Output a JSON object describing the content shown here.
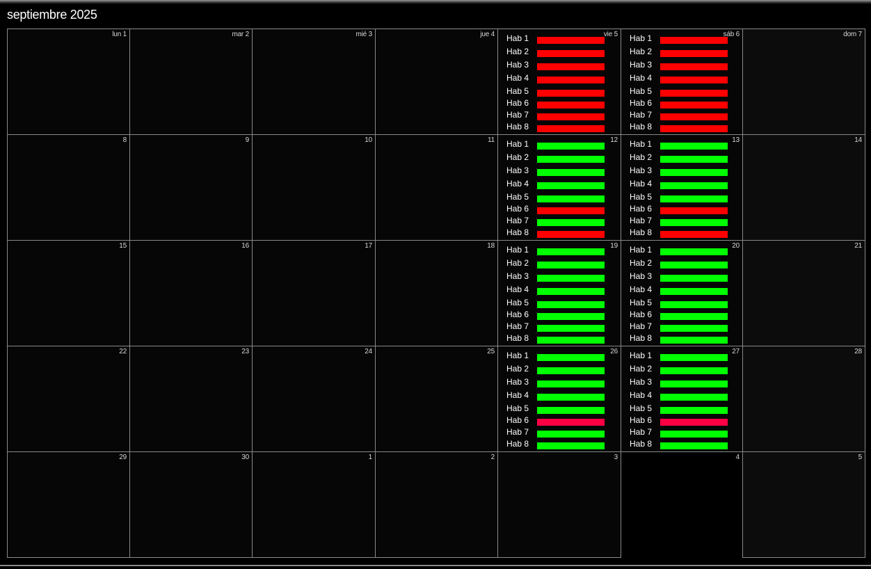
{
  "calendar": {
    "title": "septiembre 2025",
    "colors": {
      "available": "#00ff00",
      "occupied": "#ff0000",
      "blocked": "#ff0044"
    },
    "weeks": [
      {
        "days": [
          {
            "label": "lun 1"
          },
          {
            "label": "mar 2"
          },
          {
            "label": "mié 3"
          },
          {
            "label": "jue 4"
          },
          {
            "label": "vie 5",
            "rooms": [
              {
                "name": "Hab 1",
                "status": "occupied"
              },
              {
                "name": "Hab 2",
                "status": "occupied"
              },
              {
                "name": "Hab 3",
                "status": "occupied"
              },
              {
                "name": "Hab 4",
                "status": "occupied"
              },
              {
                "name": "Hab 5",
                "status": "occupied"
              },
              {
                "name": "Hab 6",
                "status": "occupied"
              },
              {
                "name": "Hab 7",
                "status": "occupied"
              },
              {
                "name": "Hab 8",
                "status": "occupied"
              }
            ]
          },
          {
            "label": "sáb 6",
            "rooms": [
              {
                "name": "Hab 1",
                "status": "occupied"
              },
              {
                "name": "Hab 2",
                "status": "occupied"
              },
              {
                "name": "Hab 3",
                "status": "occupied"
              },
              {
                "name": "Hab 4",
                "status": "occupied"
              },
              {
                "name": "Hab 5",
                "status": "occupied"
              },
              {
                "name": "Hab 6",
                "status": "occupied"
              },
              {
                "name": "Hab 7",
                "status": "occupied"
              },
              {
                "name": "Hab 8",
                "status": "occupied"
              }
            ]
          },
          {
            "label": "dom 7"
          }
        ]
      },
      {
        "days": [
          {
            "label": "8"
          },
          {
            "label": "9"
          },
          {
            "label": "10"
          },
          {
            "label": "11"
          },
          {
            "label": "12",
            "rooms": [
              {
                "name": "Hab 1",
                "status": "available"
              },
              {
                "name": "Hab 2",
                "status": "available"
              },
              {
                "name": "Hab 3",
                "status": "available"
              },
              {
                "name": "Hab 4",
                "status": "available"
              },
              {
                "name": "Hab 5",
                "status": "available"
              },
              {
                "name": "Hab 6",
                "status": "occupied"
              },
              {
                "name": "Hab 7",
                "status": "available"
              },
              {
                "name": "Hab 8",
                "status": "occupied"
              }
            ]
          },
          {
            "label": "13",
            "rooms": [
              {
                "name": "Hab 1",
                "status": "available"
              },
              {
                "name": "Hab 2",
                "status": "available"
              },
              {
                "name": "Hab 3",
                "status": "available"
              },
              {
                "name": "Hab 4",
                "status": "available"
              },
              {
                "name": "Hab 5",
                "status": "available"
              },
              {
                "name": "Hab 6",
                "status": "occupied"
              },
              {
                "name": "Hab 7",
                "status": "available"
              },
              {
                "name": "Hab 8",
                "status": "occupied"
              }
            ]
          },
          {
            "label": "14"
          }
        ]
      },
      {
        "days": [
          {
            "label": "15"
          },
          {
            "label": "16"
          },
          {
            "label": "17"
          },
          {
            "label": "18"
          },
          {
            "label": "19",
            "rooms": [
              {
                "name": "Hab 1",
                "status": "available"
              },
              {
                "name": "Hab 2",
                "status": "available"
              },
              {
                "name": "Hab 3",
                "status": "available"
              },
              {
                "name": "Hab 4",
                "status": "available"
              },
              {
                "name": "Hab 5",
                "status": "available"
              },
              {
                "name": "Hab 6",
                "status": "available"
              },
              {
                "name": "Hab 7",
                "status": "available"
              },
              {
                "name": "Hab 8",
                "status": "available"
              }
            ]
          },
          {
            "label": "20",
            "rooms": [
              {
                "name": "Hab 1",
                "status": "available"
              },
              {
                "name": "Hab 2",
                "status": "available"
              },
              {
                "name": "Hab 3",
                "status": "available"
              },
              {
                "name": "Hab 4",
                "status": "available"
              },
              {
                "name": "Hab 5",
                "status": "available"
              },
              {
                "name": "Hab 6",
                "status": "available"
              },
              {
                "name": "Hab 7",
                "status": "available"
              },
              {
                "name": "Hab 8",
                "status": "available"
              }
            ]
          },
          {
            "label": "21"
          }
        ]
      },
      {
        "days": [
          {
            "label": "22"
          },
          {
            "label": "23"
          },
          {
            "label": "24"
          },
          {
            "label": "25"
          },
          {
            "label": "26",
            "rooms": [
              {
                "name": "Hab 1",
                "status": "available"
              },
              {
                "name": "Hab 2",
                "status": "available"
              },
              {
                "name": "Hab 3",
                "status": "available"
              },
              {
                "name": "Hab 4",
                "status": "available"
              },
              {
                "name": "Hab 5",
                "status": "available"
              },
              {
                "name": "Hab 6",
                "status": "blocked"
              },
              {
                "name": "Hab 7",
                "status": "available"
              },
              {
                "name": "Hab 8",
                "status": "available"
              }
            ]
          },
          {
            "label": "27",
            "rooms": [
              {
                "name": "Hab 1",
                "status": "available"
              },
              {
                "name": "Hab 2",
                "status": "available"
              },
              {
                "name": "Hab 3",
                "status": "available"
              },
              {
                "name": "Hab 4",
                "status": "available"
              },
              {
                "name": "Hab 5",
                "status": "available"
              },
              {
                "name": "Hab 6",
                "status": "blocked"
              },
              {
                "name": "Hab 7",
                "status": "available"
              },
              {
                "name": "Hab 8",
                "status": "available"
              }
            ]
          },
          {
            "label": "28"
          }
        ]
      },
      {
        "days": [
          {
            "label": "29"
          },
          {
            "label": "30"
          },
          {
            "label": "1"
          },
          {
            "label": "2"
          },
          {
            "label": "3"
          },
          {
            "label": "4"
          },
          {
            "label": "5"
          }
        ]
      }
    ]
  }
}
